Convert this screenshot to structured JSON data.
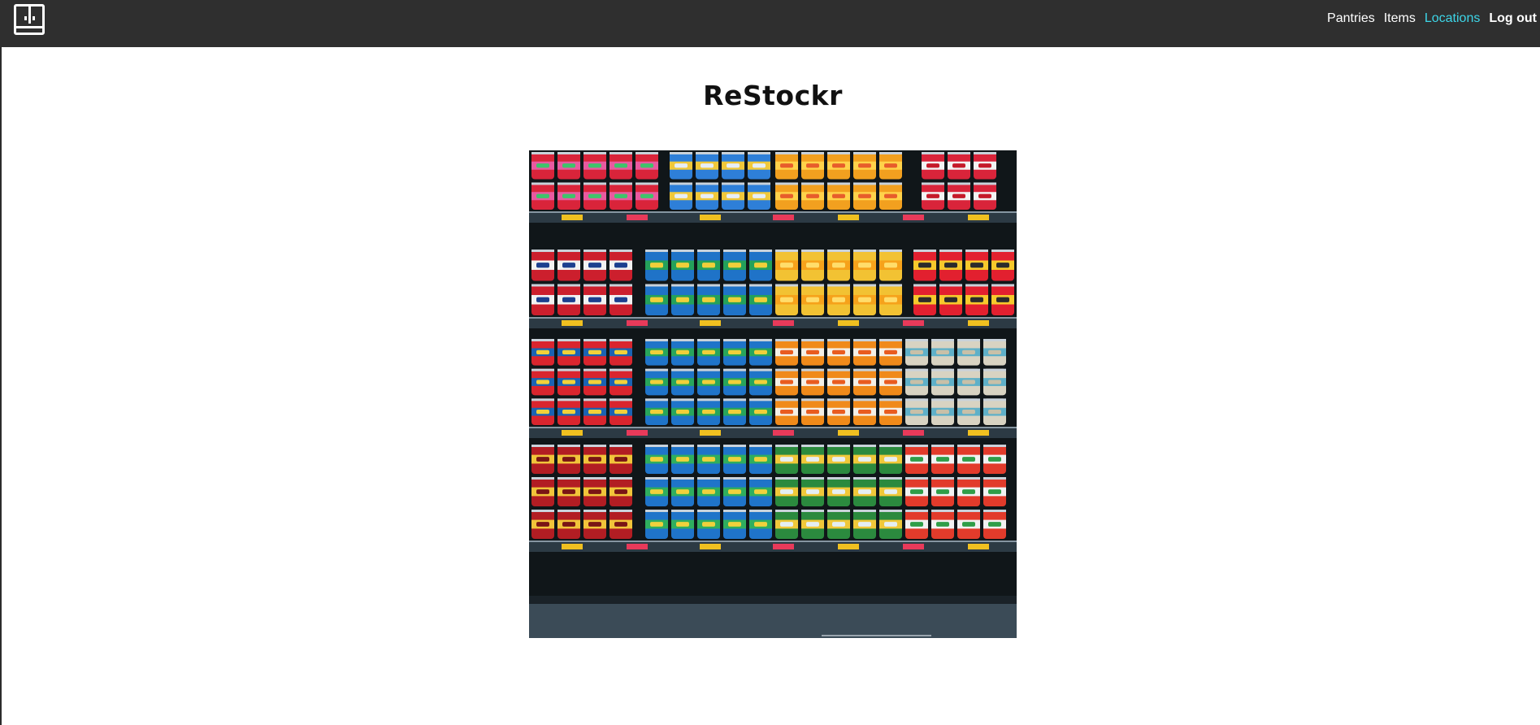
{
  "nav": {
    "links": [
      "Pantries",
      "Items",
      "Locations"
    ],
    "active": "Locations",
    "logout": "Log out"
  },
  "main": {
    "title": "ReStockr"
  },
  "colors": {
    "navbar_bg": "#2f2f2f",
    "active_link": "#3dd6e8"
  },
  "icons": [
    "pantry-logo-icon"
  ]
}
